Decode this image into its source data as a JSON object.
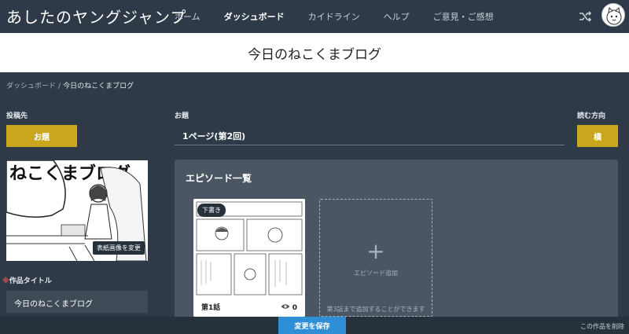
{
  "header": {
    "logo_main": "あしたのヤングジャンプ",
    "nav": [
      "ホーム",
      "ダッシュボード",
      "カイドライン",
      "ヘルプ",
      "ご意見・ご感想"
    ],
    "active_nav": 1
  },
  "page": {
    "title": "今日のねこくまブログ"
  },
  "breadcrumb": {
    "root": "ダッシュボード",
    "current": "今日のねこくまブログ"
  },
  "form": {
    "submit_to_label": "投稿先",
    "submit_to_button": "お題",
    "subject_label": "お題",
    "subject_value": "1ページ(第2回)",
    "direction_label": "読む方向",
    "direction_button": "横",
    "cover_change_button": "表紙画像を変更",
    "cover_text": "ねこくまブログ",
    "required_mark": "※",
    "work_title_label": "作品タイトル",
    "work_title_value": "今日のねこくまブログ"
  },
  "episodes": {
    "heading": "エピソード一覧",
    "items": [
      {
        "badge": "下書き",
        "name": "第1話",
        "views": "0"
      }
    ],
    "add_label": "エピソード追加",
    "add_note": "第3話まで追加することができます",
    "add_symbol": "+"
  },
  "footer": {
    "save_button": "変更を保存",
    "delete_link": "この作品を削除"
  },
  "colors": {
    "background": "#2e3a47",
    "accent_yellow": "#c9a61c",
    "save_blue": "#2f8fd6",
    "panel": "#4a5663"
  }
}
